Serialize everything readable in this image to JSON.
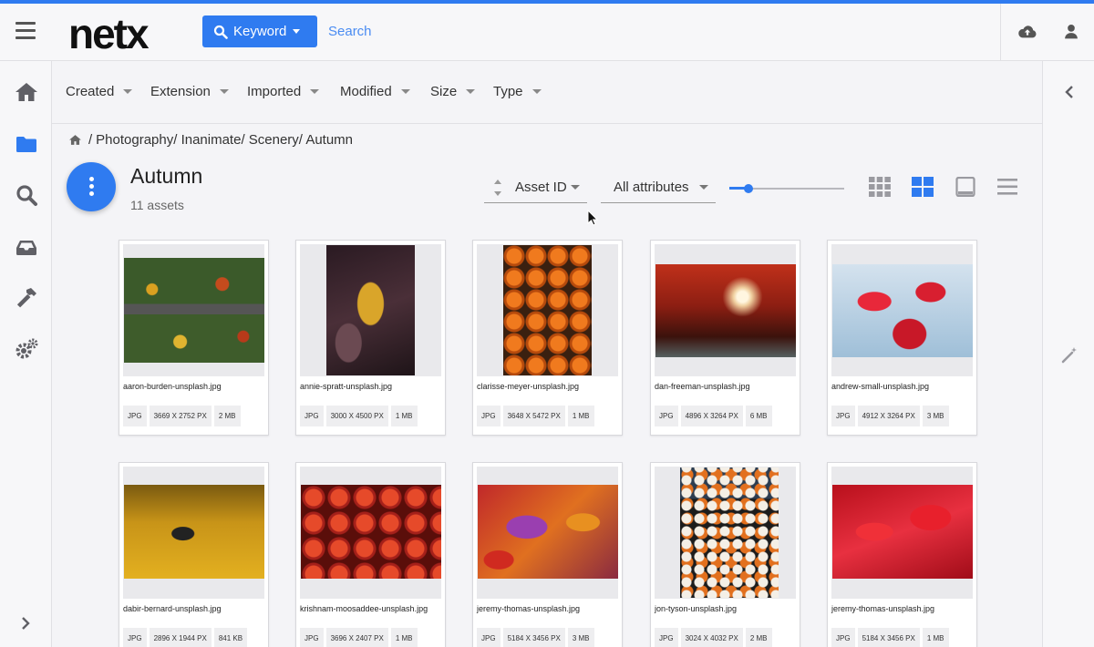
{
  "app": {
    "logo": "netx"
  },
  "header": {
    "keyword_label": "Keyword",
    "search_placeholder": "Search"
  },
  "filters": [
    "Created",
    "Extension",
    "Imported",
    "Modified",
    "Size",
    "Type"
  ],
  "breadcrumb": {
    "separator": "/",
    "path": "Photography/ Inanimate/ Scenery/ Autumn"
  },
  "folder": {
    "title": "Autumn",
    "count_label": "11 assets"
  },
  "toolbar": {
    "sort_label": "Asset ID",
    "attributes_label": "All attributes",
    "thumb_size_fraction": 0.17
  },
  "colors": {
    "accent": "#2f7bf0",
    "active_view": "#2f7bf0",
    "inactive_view": "#9a9aa0"
  },
  "assets": [
    {
      "name": "aaron-burden-unsplash.jpg",
      "ext": "JPG",
      "dims": "3669 X 2752 PX",
      "size": "2 MB"
    },
    {
      "name": "annie-spratt-unsplash.jpg",
      "ext": "JPG",
      "dims": "3000 X 4500 PX",
      "size": "1 MB"
    },
    {
      "name": "clarisse-meyer-unsplash.jpg",
      "ext": "JPG",
      "dims": "3648 X 5472 PX",
      "size": "1 MB"
    },
    {
      "name": "dan-freeman-unsplash.jpg",
      "ext": "JPG",
      "dims": "4896 X 3264 PX",
      "size": "6 MB"
    },
    {
      "name": "andrew-small-unsplash.jpg",
      "ext": "JPG",
      "dims": "4912 X 3264 PX",
      "size": "3 MB"
    },
    {
      "name": "dabir-bernard-unsplash.jpg",
      "ext": "JPG",
      "dims": "2896 X 1944 PX",
      "size": "841 KB"
    },
    {
      "name": "krishnam-moosaddee-unsplash.jpg",
      "ext": "JPG",
      "dims": "3696 X 2407 PX",
      "size": "1 MB"
    },
    {
      "name": "jeremy-thomas-unsplash.jpg",
      "ext": "JPG",
      "dims": "5184 X 3456 PX",
      "size": "3 MB"
    },
    {
      "name": "jon-tyson-unsplash.jpg",
      "ext": "JPG",
      "dims": "3024 X 4032 PX",
      "size": "2 MB"
    },
    {
      "name": "jeremy-thomas-unsplash.jpg",
      "ext": "JPG",
      "dims": "5184 X 3456 PX",
      "size": "1 MB"
    }
  ]
}
